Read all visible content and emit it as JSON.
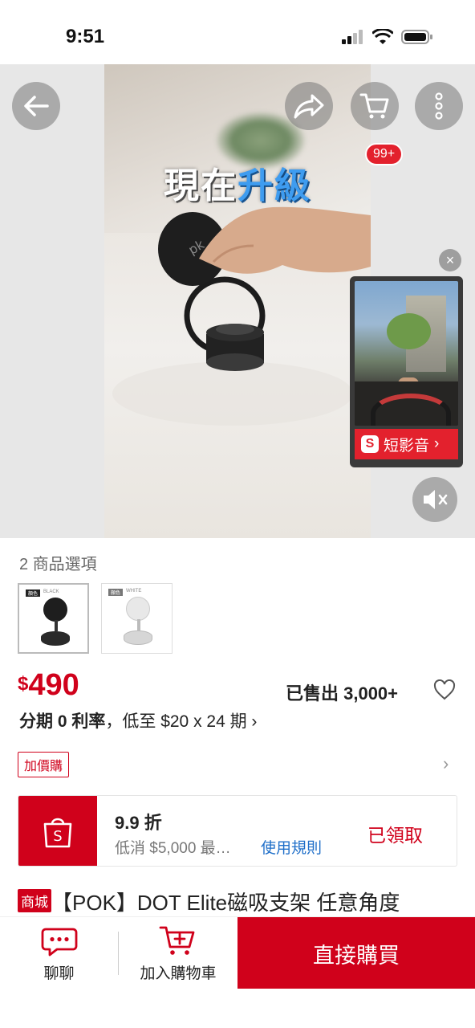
{
  "status_bar": {
    "time": "9:51"
  },
  "media": {
    "video_caption_white": "現在",
    "video_caption_blue": "升級",
    "cart_badge": "99+",
    "mini_player": {
      "logo_letter": "S",
      "label": "短影音",
      "chevron": "›",
      "close": "×"
    }
  },
  "options": {
    "label": "2 商品選項",
    "items": [
      {
        "tag": "顏色",
        "name": "BLACK"
      },
      {
        "tag": "顏色",
        "name": "WHITE"
      }
    ]
  },
  "price": {
    "currency": "$",
    "amount": "490",
    "sold": "已售出 3,000+"
  },
  "installment": {
    "prefix": "分期",
    "rate": "0 利率",
    "detail": "，低至 $20 x 24 期 ›"
  },
  "addon": {
    "label": "加價購",
    "chevron": "›"
  },
  "voucher": {
    "title": "9.9 折",
    "condition": "低消 $5,000 最…",
    "rules_link": "使用規則",
    "status": "已領取"
  },
  "product": {
    "mall_tag": "商城",
    "title": "【POK】DOT Elite磁吸支架 任意角度"
  },
  "bottom_bar": {
    "chat_label": "聊聊",
    "add_to_cart_label": "加入購物車",
    "buy_now_label": "直接購買"
  },
  "colors": {
    "brand_red": "#d0011b",
    "link_blue": "#1f6fc9"
  }
}
